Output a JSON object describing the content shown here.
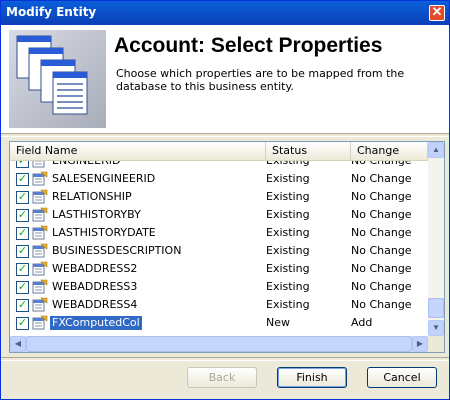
{
  "window": {
    "title": "Modify Entity"
  },
  "header": {
    "title": "Account: Select Properties",
    "description": "Choose which properties are to be mapped from the database to this business entity."
  },
  "list": {
    "columns": [
      "Field Name",
      "Status",
      "Change"
    ],
    "rows": [
      {
        "name": "ENGINEERID",
        "status": "Existing",
        "change": "No Change",
        "checked": true
      },
      {
        "name": "SALESENGINEERID",
        "status": "Existing",
        "change": "No Change",
        "checked": true
      },
      {
        "name": "RELATIONSHIP",
        "status": "Existing",
        "change": "No Change",
        "checked": true
      },
      {
        "name": "LASTHISTORYBY",
        "status": "Existing",
        "change": "No Change",
        "checked": true
      },
      {
        "name": "LASTHISTORYDATE",
        "status": "Existing",
        "change": "No Change",
        "checked": true
      },
      {
        "name": "BUSINESSDESCRIPTION",
        "status": "Existing",
        "change": "No Change",
        "checked": true
      },
      {
        "name": "WEBADDRESS2",
        "status": "Existing",
        "change": "No Change",
        "checked": true
      },
      {
        "name": "WEBADDRESS3",
        "status": "Existing",
        "change": "No Change",
        "checked": true
      },
      {
        "name": "WEBADDRESS4",
        "status": "Existing",
        "change": "No Change",
        "checked": true
      },
      {
        "name": "FXComputedCol",
        "status": "New",
        "change": "Add",
        "checked": true,
        "selected": true
      }
    ]
  },
  "buttons": {
    "back": "Back",
    "finish": "Finish",
    "cancel": "Cancel"
  },
  "icons": {
    "close": "close-icon",
    "header": "entity-grid-stack-icon",
    "row": "property-icon"
  },
  "colors": {
    "titlebar": "#0b50c8",
    "selection": "#316ac5",
    "check": "#21a121"
  }
}
